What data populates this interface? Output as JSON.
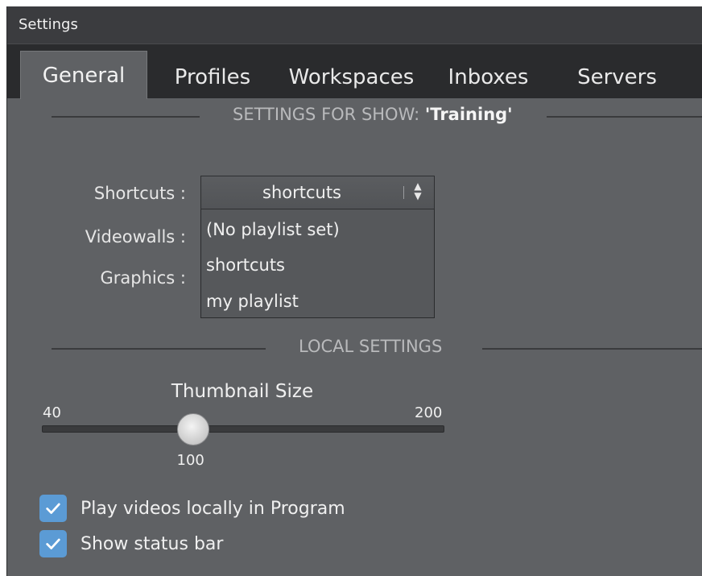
{
  "window": {
    "title": "Settings"
  },
  "tabs": [
    {
      "label": "General",
      "active": true
    },
    {
      "label": "Profiles",
      "active": false
    },
    {
      "label": "Workspaces",
      "active": false
    },
    {
      "label": "Inboxes",
      "active": false
    },
    {
      "label": "Servers",
      "active": false
    }
  ],
  "show_settings": {
    "header_prefix": "SETTINGS FOR SHOW: ",
    "header_show_name": "'Training'",
    "fields": {
      "shortcuts_label": "Shortcuts :",
      "videowalls_label": "Videowalls :",
      "graphics_label": "Graphics :"
    },
    "shortcuts_select": {
      "value": "shortcuts",
      "expanded": true,
      "options": [
        "(No playlist set)",
        "shortcuts",
        "my playlist"
      ]
    }
  },
  "local_settings": {
    "header": "LOCAL SETTINGS",
    "thumbnail_size": {
      "title": "Thumbnail Size",
      "min": "40",
      "max": "200",
      "value": "100",
      "min_num": 40,
      "max_num": 200,
      "value_num": 100
    },
    "checkboxes": [
      {
        "label": "Play videos locally in Program",
        "checked": true
      },
      {
        "label": "Show status bar",
        "checked": true
      }
    ]
  },
  "colors": {
    "panel_bg": "#5f6164",
    "tabstrip_bg": "#2a2b2d",
    "checkbox_accent": "#5b9bd5"
  }
}
